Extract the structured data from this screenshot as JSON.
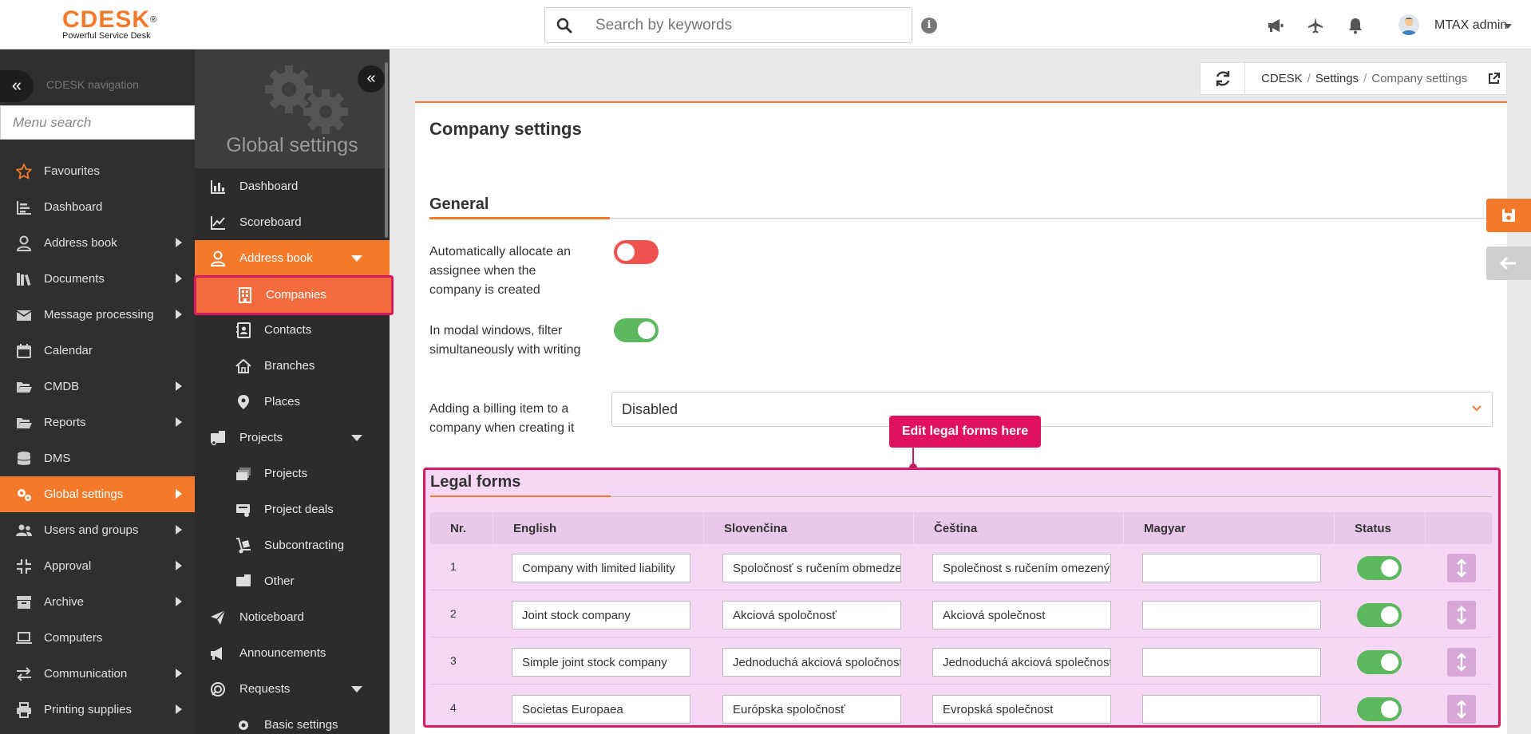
{
  "header": {
    "logo_text": "CDESK",
    "logo_tagline": "Powerful Service Desk",
    "search_placeholder": "Search by keywords",
    "user_name": "MTAX admin"
  },
  "sidebar": {
    "title": "CDESK navigation",
    "search_placeholder": "Menu search",
    "items": [
      {
        "label": "Favourites",
        "icon": "star-icon"
      },
      {
        "label": "Dashboard",
        "icon": "dashboard-icon"
      },
      {
        "label": "Address book",
        "icon": "user-icon"
      },
      {
        "label": "Documents",
        "icon": "books-icon"
      },
      {
        "label": "Message processing",
        "icon": "envelope-icon"
      },
      {
        "label": "Calendar",
        "icon": "calendar-icon"
      },
      {
        "label": "CMDB",
        "icon": "folder-open-icon"
      },
      {
        "label": "Reports",
        "icon": "folder-open-icon"
      },
      {
        "label": "DMS",
        "icon": "database-icon"
      },
      {
        "label": "Global settings",
        "icon": "gears-icon"
      },
      {
        "label": "Users and groups",
        "icon": "users-icon"
      },
      {
        "label": "Approval",
        "icon": "compress-icon"
      },
      {
        "label": "Archive",
        "icon": "archive-icon"
      },
      {
        "label": "Computers",
        "icon": "laptop-icon"
      },
      {
        "label": "Communication",
        "icon": "exchange-icon"
      },
      {
        "label": "Printing supplies",
        "icon": "printer-icon"
      }
    ]
  },
  "panel2": {
    "title": "Global settings",
    "items": [
      {
        "label": "Dashboard"
      },
      {
        "label": "Scoreboard"
      },
      {
        "label": "Address book"
      },
      {
        "label": "Companies"
      },
      {
        "label": "Contacts"
      },
      {
        "label": "Branches"
      },
      {
        "label": "Places"
      },
      {
        "label": "Projects"
      },
      {
        "label": "Projects"
      },
      {
        "label": "Project deals"
      },
      {
        "label": "Subcontracting"
      },
      {
        "label": "Other"
      },
      {
        "label": "Noticeboard"
      },
      {
        "label": "Announcements"
      },
      {
        "label": "Requests"
      },
      {
        "label": "Basic settings"
      }
    ]
  },
  "breadcrumb": {
    "items": [
      "CDESK",
      "Settings",
      "Company settings"
    ]
  },
  "page": {
    "title": "Company settings",
    "section_general": "General",
    "settings": [
      {
        "label": "Automatically allocate an assignee when the company is created",
        "state": "off"
      },
      {
        "label": "In modal windows, filter simultaneously with writing",
        "state": "on"
      },
      {
        "label": "Adding a billing item to a company when creating it",
        "value": "Disabled"
      }
    ],
    "tooltip": "Edit legal forms here",
    "section_legal": "Legal forms",
    "table": {
      "columns": [
        "Nr.",
        "English",
        "Slovenčina",
        "Čeština",
        "Magyar",
        "Status"
      ],
      "rows": [
        {
          "nr": "1",
          "en": "Company with limited liability",
          "sk": "Spoločnosť s ručením obmedzeným",
          "cs": "Společnost s ručením omezeným",
          "hu": "",
          "status": "on"
        },
        {
          "nr": "2",
          "en": "Joint stock company",
          "sk": "Akciová spoločnosť",
          "cs": "Akciová společnost",
          "hu": "",
          "status": "on"
        },
        {
          "nr": "3",
          "en": "Simple joint stock company",
          "sk": "Jednoduchá akciová spoločnosť",
          "cs": "Jednoduchá akciová společnost",
          "hu": "",
          "status": "on"
        },
        {
          "nr": "4",
          "en": "Societas Europaea",
          "sk": "Európska spoločnosť",
          "cs": "Evropská společnost",
          "hu": "",
          "status": "on"
        }
      ]
    }
  },
  "colors": {
    "accent": "#f37a2a",
    "highlight": "#d81b60",
    "toggle_on": "#5cb85c",
    "toggle_off": "#ef5350"
  }
}
